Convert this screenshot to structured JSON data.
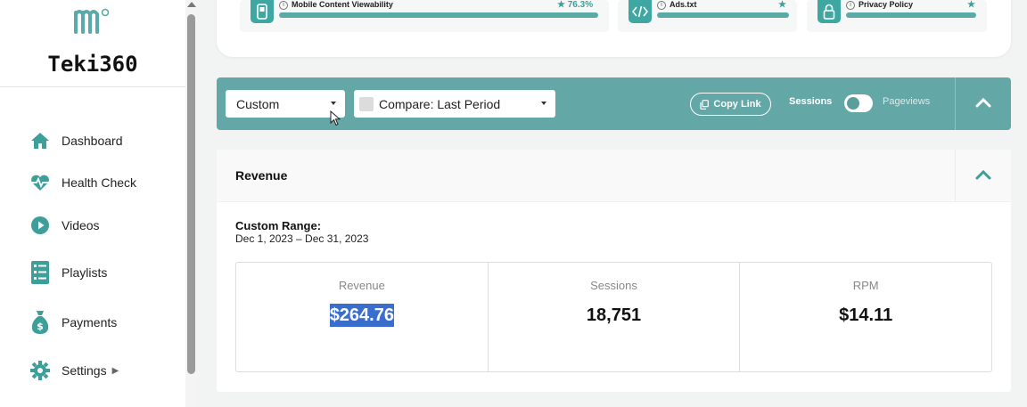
{
  "brand": {
    "name": "Teki360"
  },
  "sidebar": {
    "items": [
      {
        "label": "Dashboard",
        "icon": "home-icon"
      },
      {
        "label": "Health Check",
        "icon": "heartbeat-icon"
      },
      {
        "label": "Videos",
        "icon": "play-icon"
      },
      {
        "label": "Playlists",
        "icon": "list-icon"
      },
      {
        "label": "Payments",
        "icon": "money-bag-icon"
      },
      {
        "label": "Settings",
        "icon": "gear-icon"
      }
    ]
  },
  "health_checks": [
    {
      "name": "Mobile Content Viewability",
      "score": "76.3%",
      "icon": "mobile-icon"
    },
    {
      "name": "Ads.txt",
      "icon": "code-icon"
    },
    {
      "name": "Privacy Policy",
      "icon": "lock-icon"
    }
  ],
  "filters": {
    "range_select": "Custom",
    "compare_select": "Compare: Last Period",
    "copy_link": "Copy Link",
    "toggle_left": "Sessions",
    "toggle_right": "Pageviews"
  },
  "revenue": {
    "title": "Revenue",
    "range_label": "Custom Range:",
    "range_dates": "Dec 1, 2023 – Dec 31, 2023",
    "metrics": [
      {
        "label": "Revenue",
        "value": "$264.76"
      },
      {
        "label": "Sessions",
        "value": "18,751"
      },
      {
        "label": "RPM",
        "value": "$14.11"
      }
    ]
  },
  "colors": {
    "teal": "#63a7a6",
    "accent": "#3ea7a2",
    "selection": "#3a6ecc"
  }
}
